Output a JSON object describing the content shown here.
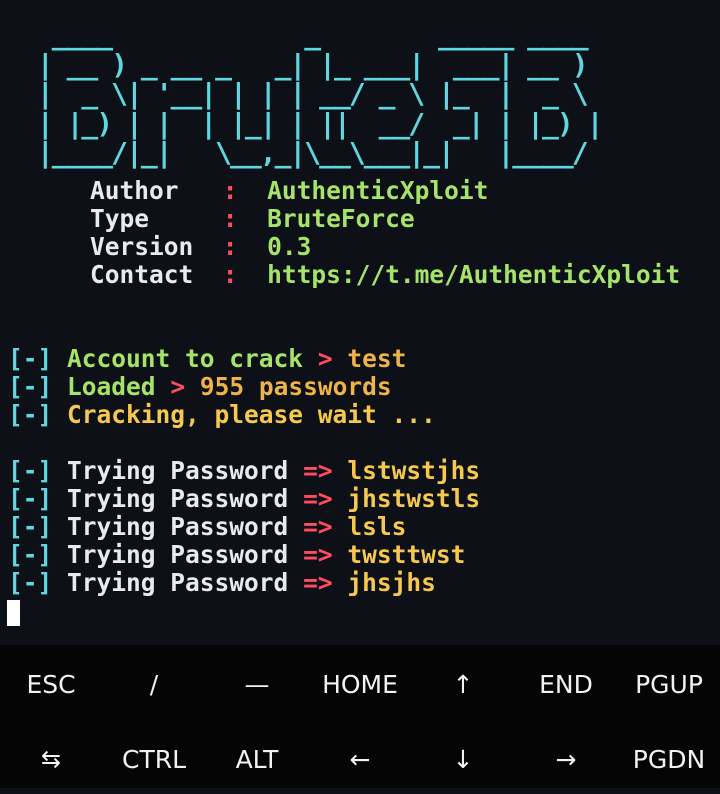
{
  "banner": {
    "ascii": "  ____             _        _____ ____  \n | __ ) _ __ _   _| |_ ___|  ___| __ ) \n |  _ \\| '__| | | | __/ _ \\ |_  |  _ \\ \n | |_) | |  | |_| | ||  __/  _| | |_) |\n |____/|_|   \\__,_|\\__\\___|_|   |____/ "
  },
  "info": [
    {
      "key": "Author ",
      "sep": ":",
      "value": "AuthenticXploit"
    },
    {
      "key": "Type   ",
      "sep": ":",
      "value": "BruteForce"
    },
    {
      "key": "Version",
      "sep": ":",
      "value": "0.3"
    },
    {
      "key": "Contact",
      "sep": ":",
      "value": "https://t.me/AuthenticXploit"
    }
  ],
  "status": {
    "account": {
      "prefix": "[-]",
      "label": "Account to crack",
      "arrow": ">",
      "value": "test"
    },
    "loaded": {
      "prefix": "[-]",
      "label": "Loaded",
      "arrow": ">",
      "value": "955 passwords"
    },
    "cracking": {
      "prefix": "[-]",
      "text": "Cracking, please wait ..."
    }
  },
  "attempts": [
    {
      "prefix": "[-]",
      "label": "Trying Password",
      "arrow": "=>",
      "value": "lstwstjhs"
    },
    {
      "prefix": "[-]",
      "label": "Trying Password",
      "arrow": "=>",
      "value": "jhstwstls"
    },
    {
      "prefix": "[-]",
      "label": "Trying Password",
      "arrow": "=>",
      "value": "lsls"
    },
    {
      "prefix": "[-]",
      "label": "Trying Password",
      "arrow": "=>",
      "value": "twsttwst"
    },
    {
      "prefix": "[-]",
      "label": "Trying Password",
      "arrow": "=>",
      "value": "jhsjhs"
    }
  ],
  "extra_keys": {
    "row1": [
      "ESC",
      "/",
      "—",
      "HOME",
      "↑",
      "END",
      "PGUP"
    ],
    "row2": [
      "⇆",
      "CTRL",
      "ALT",
      "←",
      "↓",
      "→",
      "PGDN"
    ]
  },
  "colors": {
    "background": "#0d1117",
    "cyan": "#5fd7e0",
    "green": "#a6e36b",
    "red": "#ff4d5e",
    "yellow": "#f6c84e",
    "keybar": "#050505"
  }
}
